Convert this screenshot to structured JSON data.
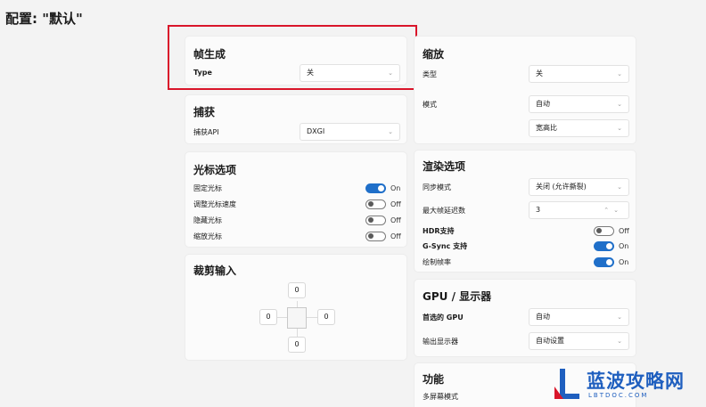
{
  "page_title": "配置: \"默认\"",
  "frame_gen": {
    "title": "帧生成",
    "type_label": "Type",
    "type_value": "关"
  },
  "capture": {
    "title": "捕获",
    "api_label": "捕获API",
    "api_value": "DXGI"
  },
  "cursor": {
    "title": "光标选项",
    "items": [
      {
        "label": "固定光标",
        "state": "On"
      },
      {
        "label": "调整光标速度",
        "state": "Off"
      },
      {
        "label": "隐藏光标",
        "state": "Off"
      },
      {
        "label": "缩放光标",
        "state": "Off"
      }
    ]
  },
  "crop": {
    "title": "裁剪输入",
    "top": "0",
    "left": "0",
    "right": "0",
    "bottom": "0"
  },
  "scale": {
    "title": "缩放",
    "type_label": "类型",
    "type_value": "关",
    "mode_label": "模式",
    "mode_value": "自动",
    "aspect_value": "宽高比"
  },
  "render": {
    "title": "渲染选项",
    "vsync_label": "同步模式",
    "vsync_value": "关闭 (允许撕裂)",
    "maxframes_label": "最大帧延迟数",
    "maxframes_value": "3",
    "toggles": [
      {
        "label": "HDR支持",
        "state": "Off"
      },
      {
        "label": "G-Sync 支持",
        "state": "On"
      },
      {
        "label": "绘制帧率",
        "state": "On"
      }
    ]
  },
  "gpu": {
    "title": "GPU / 显示器",
    "gpu_label": "首选的 GPU",
    "gpu_value": "自动",
    "display_label": "输出显示器",
    "display_value": "自动设置"
  },
  "features": {
    "title": "功能",
    "multiscreen_label": "多屏幕模式"
  },
  "watermark": {
    "text": "蓝波攻略网",
    "sub": "LBTDOC.COM"
  },
  "colors": {
    "accent": "#1f6fc9",
    "highlight": "#d9152a"
  },
  "icons": {
    "chevron": "chevron-down-icon"
  }
}
